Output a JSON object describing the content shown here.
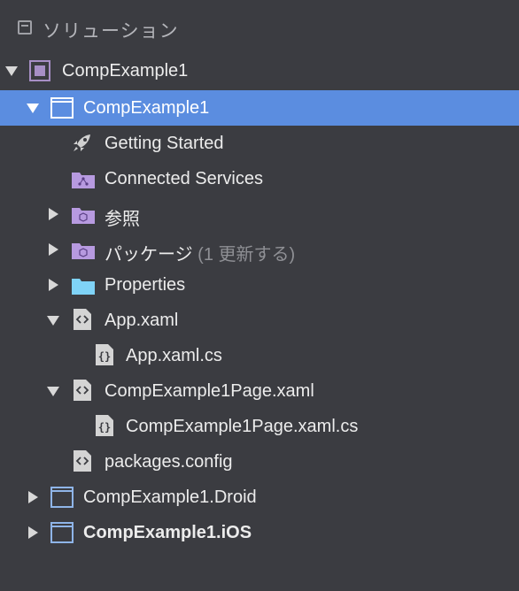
{
  "header": {
    "title": "ソリューション",
    "icon": "solution-pad-icon"
  },
  "tree": {
    "solution": {
      "label": "CompExample1",
      "icon": "solution-icon"
    },
    "project_main": {
      "label": "CompExample1",
      "icon": "project-icon",
      "selected": true
    },
    "getting_started": {
      "label": "Getting Started",
      "icon": "rocket-icon"
    },
    "connected_services": {
      "label": "Connected Services",
      "icon": "connected-services-folder-icon"
    },
    "references": {
      "label": "参照",
      "icon": "references-folder-icon"
    },
    "packages": {
      "label": "パッケージ",
      "note": "(1 更新する)",
      "icon": "packages-folder-icon"
    },
    "properties": {
      "label": "Properties",
      "icon": "folder-icon"
    },
    "app_xaml": {
      "label": "App.xaml",
      "icon": "xaml-file-icon"
    },
    "app_xaml_cs": {
      "label": "App.xaml.cs",
      "icon": "cs-file-icon"
    },
    "page_xaml": {
      "label": "CompExample1Page.xaml",
      "icon": "xaml-file-icon"
    },
    "page_xaml_cs": {
      "label": "CompExample1Page.xaml.cs",
      "icon": "cs-file-icon"
    },
    "packages_config": {
      "label": "packages.config",
      "icon": "config-file-icon"
    },
    "project_droid": {
      "label": "CompExample1.Droid",
      "icon": "project-icon"
    },
    "project_ios": {
      "label": "CompExample1.iOS",
      "icon": "project-icon",
      "bold": true
    }
  },
  "colors": {
    "background": "#3b3c41",
    "selection": "#5b8de0",
    "solution_purple": "#a78fc6",
    "project_blue": "#8fb5e8",
    "folder_cyan": "#7fd3f7"
  }
}
